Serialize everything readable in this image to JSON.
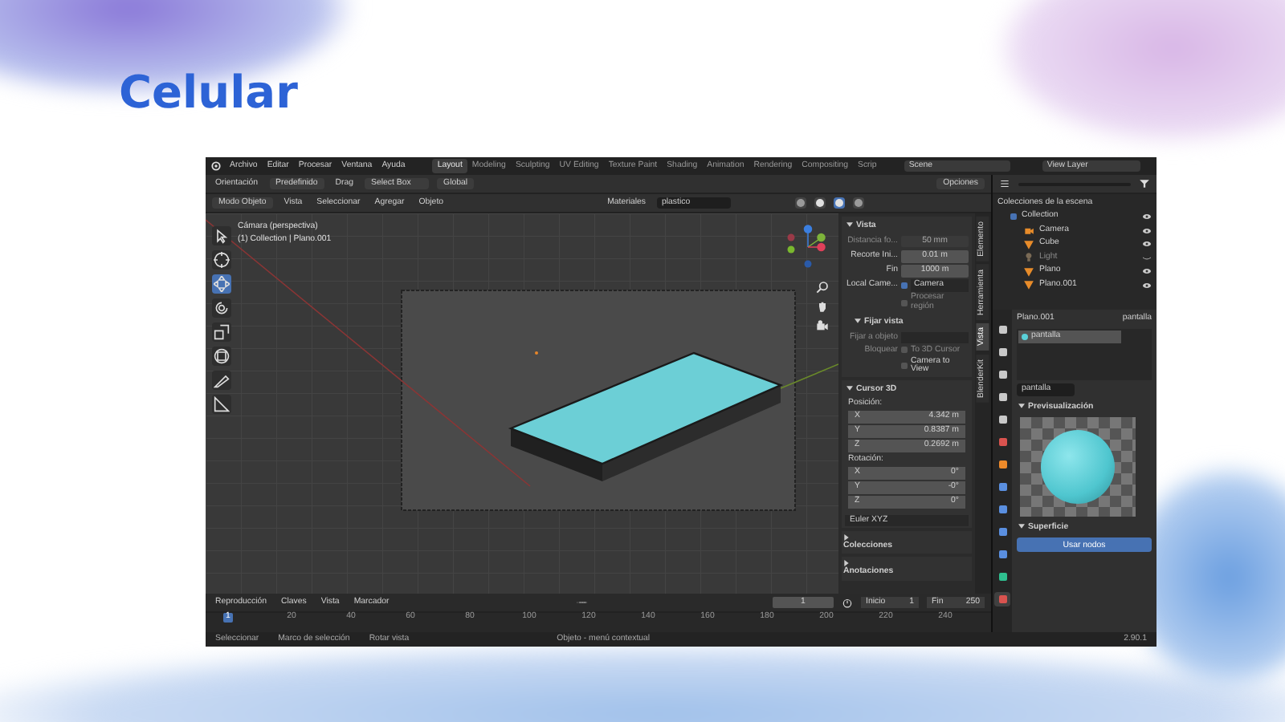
{
  "slide_title": "Celular",
  "menu": [
    "Archivo",
    "Editar",
    "Procesar",
    "Ventana",
    "Ayuda"
  ],
  "workspaces": [
    {
      "label": "Layout",
      "selected": true
    },
    {
      "label": "Modeling",
      "selected": false
    },
    {
      "label": "Sculpting",
      "selected": false
    },
    {
      "label": "UV Editing",
      "selected": false
    },
    {
      "label": "Texture Paint",
      "selected": false
    },
    {
      "label": "Shading",
      "selected": false
    },
    {
      "label": "Animation",
      "selected": false
    },
    {
      "label": "Rendering",
      "selected": false
    },
    {
      "label": "Compositing",
      "selected": false
    },
    {
      "label": "Scrip",
      "selected": false
    }
  ],
  "scene": "Scene",
  "view_layer": "View Layer",
  "tool_header": {
    "orientation": "Orientación",
    "pivot": "Predefinido",
    "drag_label": "Drag",
    "drag": "Select Box",
    "transform": "Global",
    "options": "Opciones"
  },
  "viewport_header": {
    "mode": "Modo Objeto",
    "menus": [
      "Vista",
      "Seleccionar",
      "Agregar",
      "Objeto"
    ],
    "shading": "Materiales",
    "search": "plastico",
    "shading_modes": [
      {
        "kind": "wireframe",
        "selected": false
      },
      {
        "kind": "solid",
        "selected": false
      },
      {
        "kind": "material",
        "selected": true
      },
      {
        "kind": "rendered",
        "selected": false
      }
    ]
  },
  "viewport": {
    "camera_label": "Cámara (perspectiva)",
    "object_label": "(1) Collection | Plano.001",
    "tools": [
      {
        "kind": "select",
        "selected": false
      },
      {
        "kind": "cursor",
        "selected": false
      },
      {
        "kind": "move",
        "selected": true
      },
      {
        "kind": "rotate",
        "selected": false
      },
      {
        "kind": "scale",
        "selected": false
      },
      {
        "kind": "transform",
        "selected": false
      },
      {
        "kind": "annotate",
        "selected": false
      },
      {
        "kind": "measure",
        "selected": false
      }
    ]
  },
  "sidebar": {
    "tabs": [
      {
        "label": "Elemento",
        "selected": false
      },
      {
        "label": "Herramienta",
        "selected": false
      },
      {
        "label": "Vista",
        "selected": true
      },
      {
        "label": "BlenderKit",
        "selected": false
      }
    ],
    "vista": {
      "title": "Vista",
      "fields": [
        {
          "label": "Distancia fo...",
          "value": "50 mm",
          "disabled": true
        },
        {
          "label": "Recorte  Ini...",
          "value": "0.01 m",
          "disabled": false
        },
        {
          "label": "Fin",
          "value": "1000 m",
          "disabled": false
        }
      ],
      "local_camera": {
        "label": "Local Came...",
        "checked": true,
        "value": "Camera"
      },
      "render_region": {
        "label": "Procesar región",
        "checked": false
      }
    },
    "lock": {
      "title": "Fijar vista",
      "object_label": "Fijar a objeto",
      "lock_label": "Bloquear",
      "checks": [
        {
          "label": "To 3D Cursor",
          "checked": false
        },
        {
          "label": "Camera to View",
          "checked": false
        }
      ]
    },
    "cursor": {
      "title": "Cursor 3D",
      "position_label": "Posición:",
      "position": [
        {
          "axis": "X",
          "value": "4.342 m"
        },
        {
          "axis": "Y",
          "value": "0.8387 m"
        },
        {
          "axis": "Z",
          "value": "0.2692 m"
        }
      ],
      "rotation_label": "Rotación:",
      "rotation": [
        {
          "axis": "X",
          "value": "0°"
        },
        {
          "axis": "Y",
          "value": "-0°"
        },
        {
          "axis": "Z",
          "value": "0°"
        }
      ],
      "rotation_mode": "Euler XYZ"
    },
    "collapsed": [
      "Colecciones",
      "Anotaciones"
    ]
  },
  "outliner": {
    "title": "Colecciones de la escena",
    "collection": {
      "label": "Collection",
      "checked": true,
      "children": [
        {
          "label": "Camera",
          "kind": "camera",
          "hidden": false
        },
        {
          "label": "Cube",
          "kind": "mesh",
          "hidden": false
        },
        {
          "label": "Light",
          "kind": "light",
          "hidden": true
        },
        {
          "label": "Plano",
          "kind": "mesh",
          "hidden": false
        },
        {
          "label": "Plano.001",
          "kind": "mesh",
          "hidden": false
        }
      ]
    }
  },
  "properties": {
    "object": "Plano.001",
    "material": "pantalla",
    "slots": [
      {
        "label": "pantalla",
        "selected": true
      }
    ],
    "material_field": "pantalla",
    "preview_title": "Previsualización",
    "surface_title": "Superficie",
    "use_nodes": "Usar nodos",
    "tabs": [
      {
        "kind": "tool",
        "selected": false
      },
      {
        "kind": "render",
        "selected": false
      },
      {
        "kind": "output",
        "selected": false
      },
      {
        "kind": "view-layer",
        "selected": false
      },
      {
        "kind": "scene",
        "selected": false
      },
      {
        "kind": "world",
        "selected": false
      },
      {
        "kind": "object",
        "selected": false
      },
      {
        "kind": "modifier",
        "selected": false
      },
      {
        "kind": "particles",
        "selected": false
      },
      {
        "kind": "physics",
        "selected": false
      },
      {
        "kind": "constraints",
        "selected": false
      },
      {
        "kind": "data",
        "selected": false
      },
      {
        "kind": "material",
        "selected": true
      }
    ]
  },
  "timeline": {
    "menus": [
      "Reproducción",
      "Claves",
      "Vista",
      "Marcador"
    ],
    "frame": "1",
    "start_label": "Inicio",
    "start": "1",
    "end_label": "Fin",
    "end": "250",
    "current": "1",
    "ticks": [
      "20",
      "40",
      "60",
      "80",
      "100",
      "120",
      "140",
      "160",
      "180",
      "200",
      "220",
      "240"
    ]
  },
  "status": {
    "items": [
      "Seleccionar",
      "Marco de selección",
      "Rotar vista",
      "Objeto - menú contextual"
    ],
    "version": "2.90.1"
  }
}
